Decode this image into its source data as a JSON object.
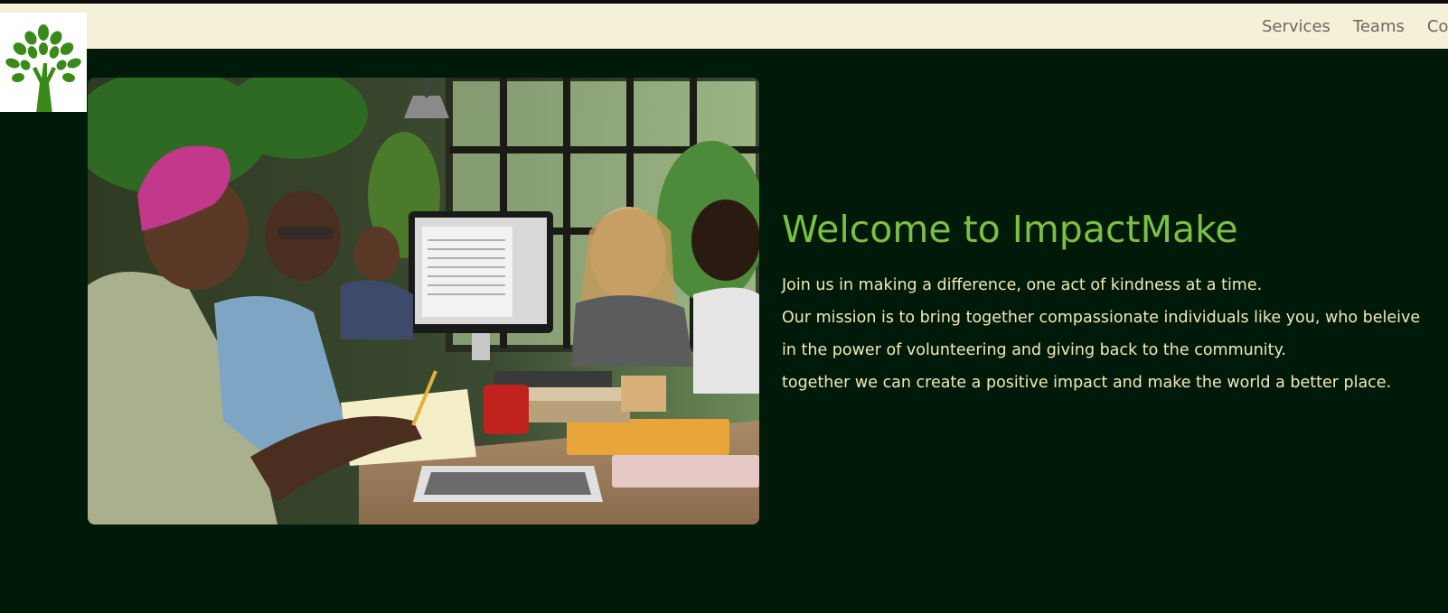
{
  "navbar": {
    "links": [
      "Services",
      "Teams",
      "Co"
    ]
  },
  "logo": {
    "icon": "tree-icon",
    "color": "#3a8a1a"
  },
  "hero": {
    "image_icon": "volunteers-photo",
    "title": "Welcome to ImpactMake",
    "lines": [
      "Join us in making a difference, one act of kindness at a time.",
      "Our mission is to bring together compassionate individuals like you, who beleive",
      "in the power of volunteering and giving back to the community.",
      "together we can create a positive impact and make the world a better place."
    ]
  },
  "colors": {
    "background": "#001a0a",
    "navbar": "#f5f0d8",
    "title": "#7bc043",
    "text": "#f2e8b6",
    "nav_text": "#6a6a5f"
  }
}
